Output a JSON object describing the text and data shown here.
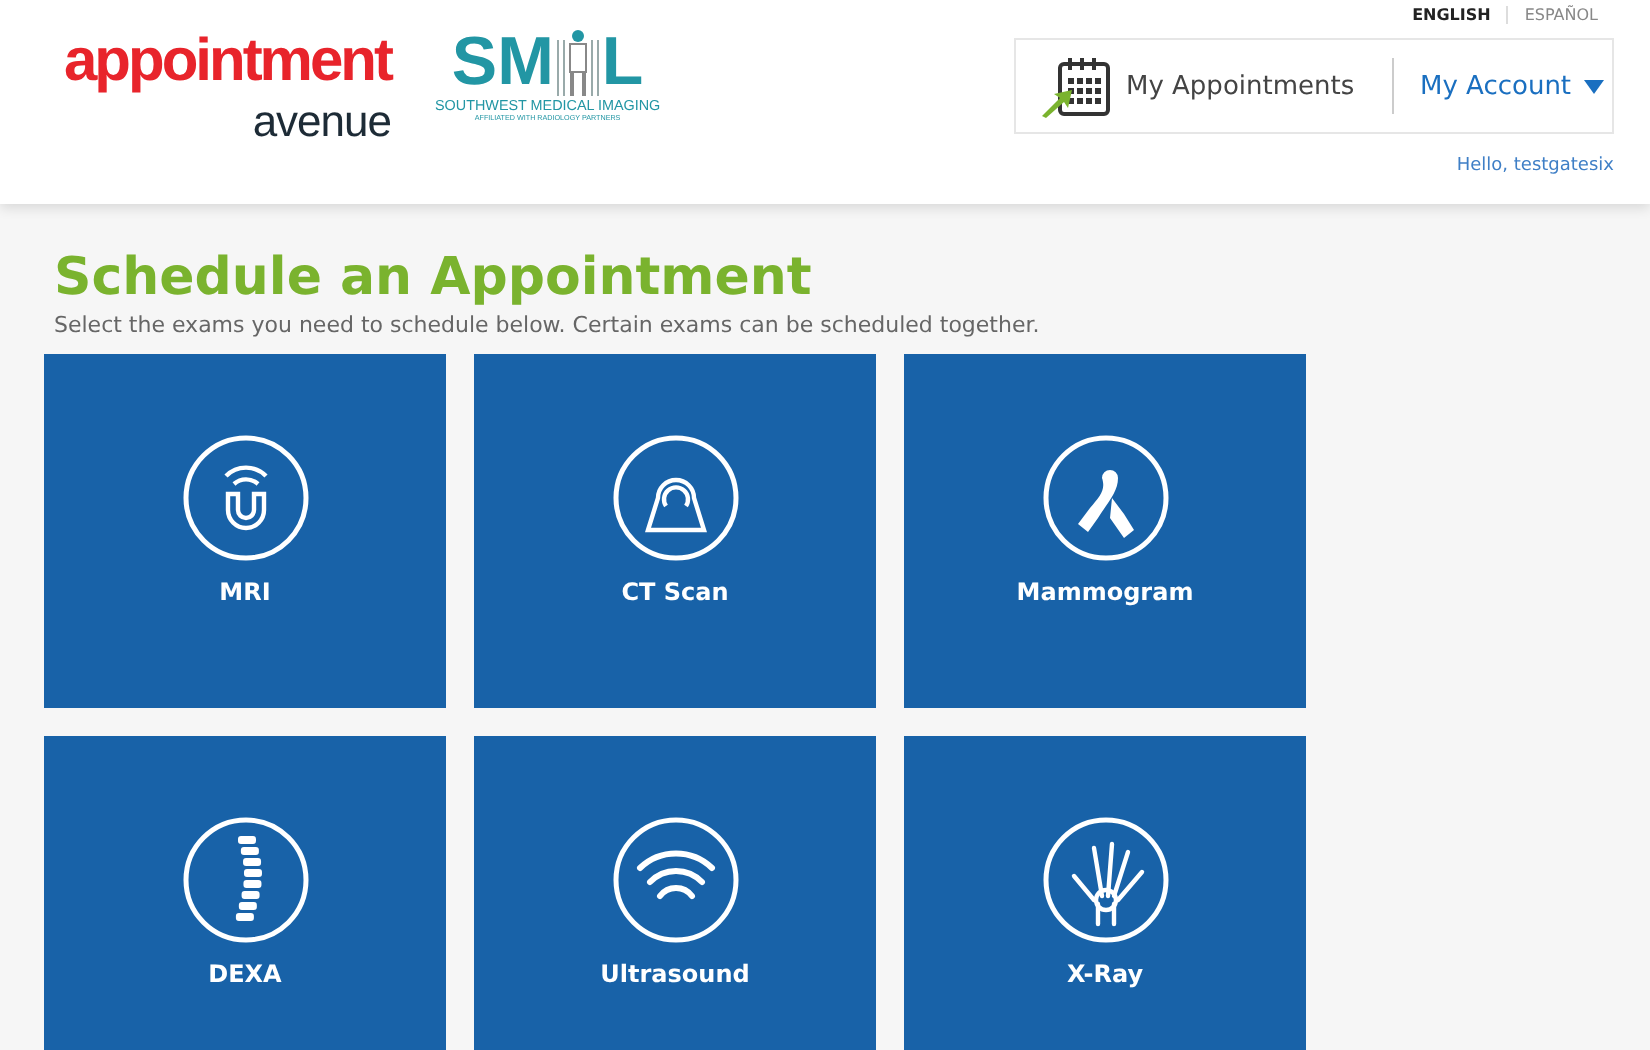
{
  "header": {
    "brand": {
      "line1": "appointment",
      "line2": "avenue"
    },
    "partner_logo": {
      "left": "SM",
      "right": "L",
      "name": "SOUTHWEST MEDICAL IMAGING",
      "tagline": "AFFILIATED WITH RADIOLOGY PARTNERS"
    },
    "languages": [
      {
        "label": "ENGLISH",
        "selected": true
      },
      {
        "label": "ESPAÑOL",
        "selected": false
      }
    ],
    "nav": {
      "appointments": "My Appointments",
      "account": "My Account"
    },
    "greeting": "Hello, testgatesix"
  },
  "main": {
    "title": "Schedule an Appointment",
    "subtitle": "Select the exams you need to schedule below. Certain exams can be scheduled together.",
    "exams": [
      {
        "label": "MRI"
      },
      {
        "label": "CT Scan"
      },
      {
        "label": "Mammogram"
      },
      {
        "label": "DEXA"
      },
      {
        "label": "Ultrasound"
      },
      {
        "label": "X-Ray"
      }
    ]
  }
}
